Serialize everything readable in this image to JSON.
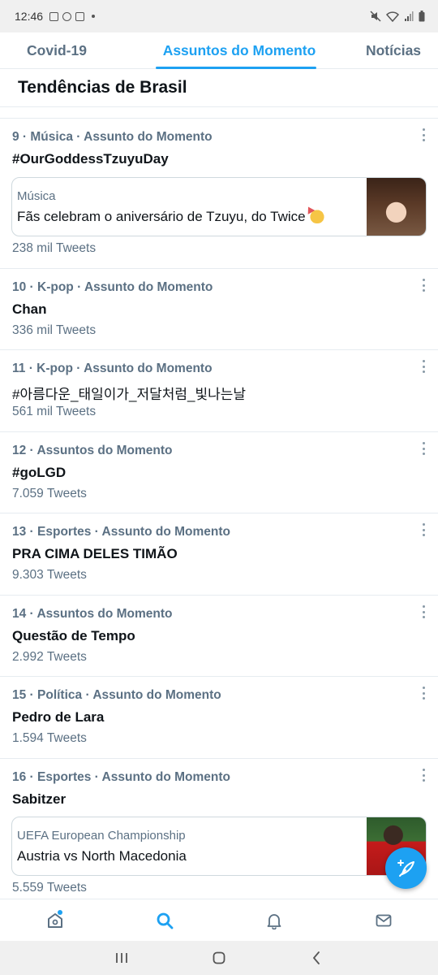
{
  "status_bar": {
    "time": "12:46",
    "notification_icons": [
      "twitch-icon",
      "whatsapp-icon",
      "twitch-icon"
    ],
    "system_icons": [
      "mute-icon",
      "wifi-icon",
      "signal-icon",
      "battery-icon"
    ]
  },
  "tabs": [
    {
      "label": "Covid-19",
      "active": false
    },
    {
      "label": "Assuntos do Momento",
      "active": true
    },
    {
      "label": "Notícias",
      "active": false
    }
  ],
  "section_title": "Tendências de Brasil",
  "trends": [
    {
      "meta": "9 · Música · Assunto do Momento",
      "name": "#OurGoddessTzuyuDay",
      "count": "238 mil Tweets",
      "card": {
        "category": "Música",
        "title": "Fãs celebram o aniversário de Tzuyu, do Twice",
        "emoji": "partying-face-icon"
      }
    },
    {
      "meta": "10 · K-pop · Assunto do Momento",
      "name": "Chan",
      "count": "336 mil Tweets"
    },
    {
      "meta": "11 · K-pop · Assunto do Momento",
      "name": "#아름다운_태일이가_저달처럼_빛나는날",
      "count": "561 mil Tweets"
    },
    {
      "meta": "12 · Assuntos do Momento",
      "name": "#goLGD",
      "count": "7.059 Tweets"
    },
    {
      "meta": "13 · Esportes · Assunto do Momento",
      "name": "PRA CIMA DELES TIMÃO",
      "count": "9.303 Tweets"
    },
    {
      "meta": "14 · Assuntos do Momento",
      "name": "Questão de Tempo",
      "count": "2.992 Tweets"
    },
    {
      "meta": "15 · Política · Assunto do Momento",
      "name": "Pedro de Lara",
      "count": "1.594 Tweets"
    },
    {
      "meta": "16 · Esportes · Assunto do Momento",
      "name": "Sabitzer",
      "count": "5.559 Tweets",
      "card": {
        "category": "UEFA European Championship",
        "title": "Austria vs North Macedonia"
      }
    }
  ],
  "bottom_nav": [
    "home-icon",
    "search-icon",
    "notifications-icon",
    "messages-icon"
  ],
  "colors": {
    "accent": "#1da1f2",
    "secondary_text": "#5b7083",
    "primary_text": "#0f1419"
  }
}
